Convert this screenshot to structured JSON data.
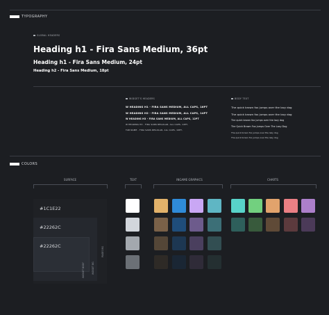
{
  "typography": {
    "section_title": "TYPOGRAPHY",
    "global_headers_label": "GLOBAL HEADERS",
    "h1": "Heading h1 - Fira Sans Medium, 36pt",
    "h2": "Heading h1 - Fira Sans Medium, 24pt",
    "h3": "Heading h2 - Fira Sans Medium, 18pt",
    "widget_headers_label": "WIDGET'S HEADERS",
    "widget_headers": [
      "W HEADING H1 - FIRA SANS MEDIUM, ALL CAPS, 16PT",
      "W HEADING H2 - FIRA SANS MEDIUM, ALL CAPS, 14PT",
      "W HEADING H3 - FIRA SANS MEDIUM, ALL CAPS, 12PT",
      "W HEADING H3 - FIRA SANS REGULAR, ALL CAPS, 12PT,",
      "TAB NAME - FIRA SANS REGULAR, ALL CAPS, 10PT,"
    ],
    "body_text_label": "BODY TEXT",
    "body_text": [
      "The quick brown fox jumps over the lazy dog",
      "The quick brown fox jumps over the lazy dog",
      "The quick brown fox jumps over the lazy dog",
      "The Quick Brown Fox Jumps Over The Lazy Dog",
      "The quick brown fox jumps over the lazy dog",
      "The quick brown fox jumps over the lazy dog"
    ]
  },
  "colors": {
    "section_title": "COLORS",
    "groups": {
      "surface": "SURFACE",
      "text": "TEXT",
      "ingame": "INGAME GRAPHICS",
      "charts": "CHARTS"
    },
    "surface": {
      "labels": [
        "#1C1E22",
        "#22262C",
        "#22262C"
      ],
      "colors": [
        "#1f2125",
        "#25282e",
        "#2b2f36"
      ],
      "side_labels": [
        "WIDGET BODY",
        "WIDGET BG",
        "PAGES BG"
      ]
    },
    "text_colors": [
      "#ffffff",
      "#d2d6dc",
      "#a3a8ae",
      "#6b7076"
    ],
    "ingame_columns": [
      [
        "#e2b26a",
        "#7a6148",
        "#544637",
        "#2e2a26"
      ],
      [
        "#2f8bd8",
        "#1f4d7a",
        "#1d3752",
        "#1a2634"
      ],
      [
        "#c9a7f4",
        "#6d5b8c",
        "#4a3f5e",
        "#2f2b38"
      ],
      [
        "#5fb6c4",
        "#3c6f77",
        "#324e52",
        "#242f31"
      ]
    ],
    "chart_columns": [
      [
        "#58d3c9",
        "#2e5f5b"
      ],
      [
        "#72d07f",
        "#385a3c"
      ],
      [
        "#e2a36c",
        "#5f4a37"
      ],
      [
        "#ea7f84",
        "#5c3a3d"
      ],
      [
        "#ac7fca",
        "#4b3a58"
      ]
    ]
  }
}
